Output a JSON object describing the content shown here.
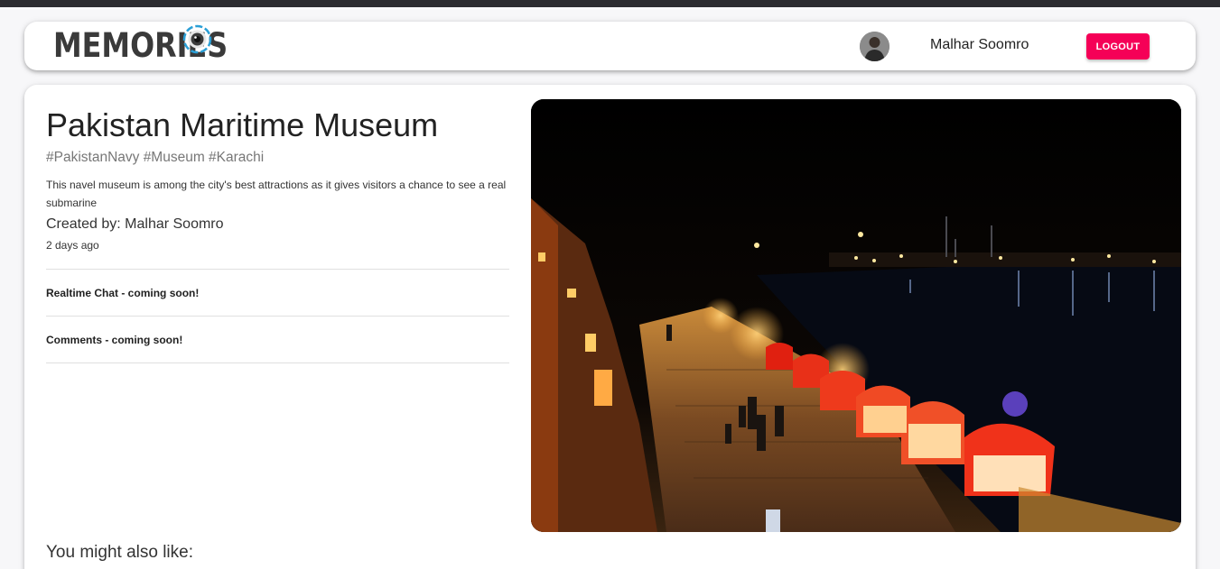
{
  "header": {
    "brand": "MEMORIES",
    "user_name": "Malhar Soomro",
    "logout_label": "LOGOUT"
  },
  "post": {
    "title": "Pakistan Maritime Museum",
    "tags": "#PakistanNavy #Museum #Karachi",
    "description": "This navel museum is among the city's best attractions as it gives visitors a chance to see a real submarine",
    "created_by": "Created by: Malhar Soomro",
    "time_ago": "2 days ago",
    "realtime_chat": "Realtime Chat - coming soon!",
    "comments": "Comments - coming soon!",
    "similar_heading": "You might also like:"
  },
  "colors": {
    "accent": "#f50057",
    "logo_ring": "#2a9fd6"
  },
  "icons": {
    "brand_logo": "camera-lens-icon",
    "avatar": "user-avatar"
  }
}
